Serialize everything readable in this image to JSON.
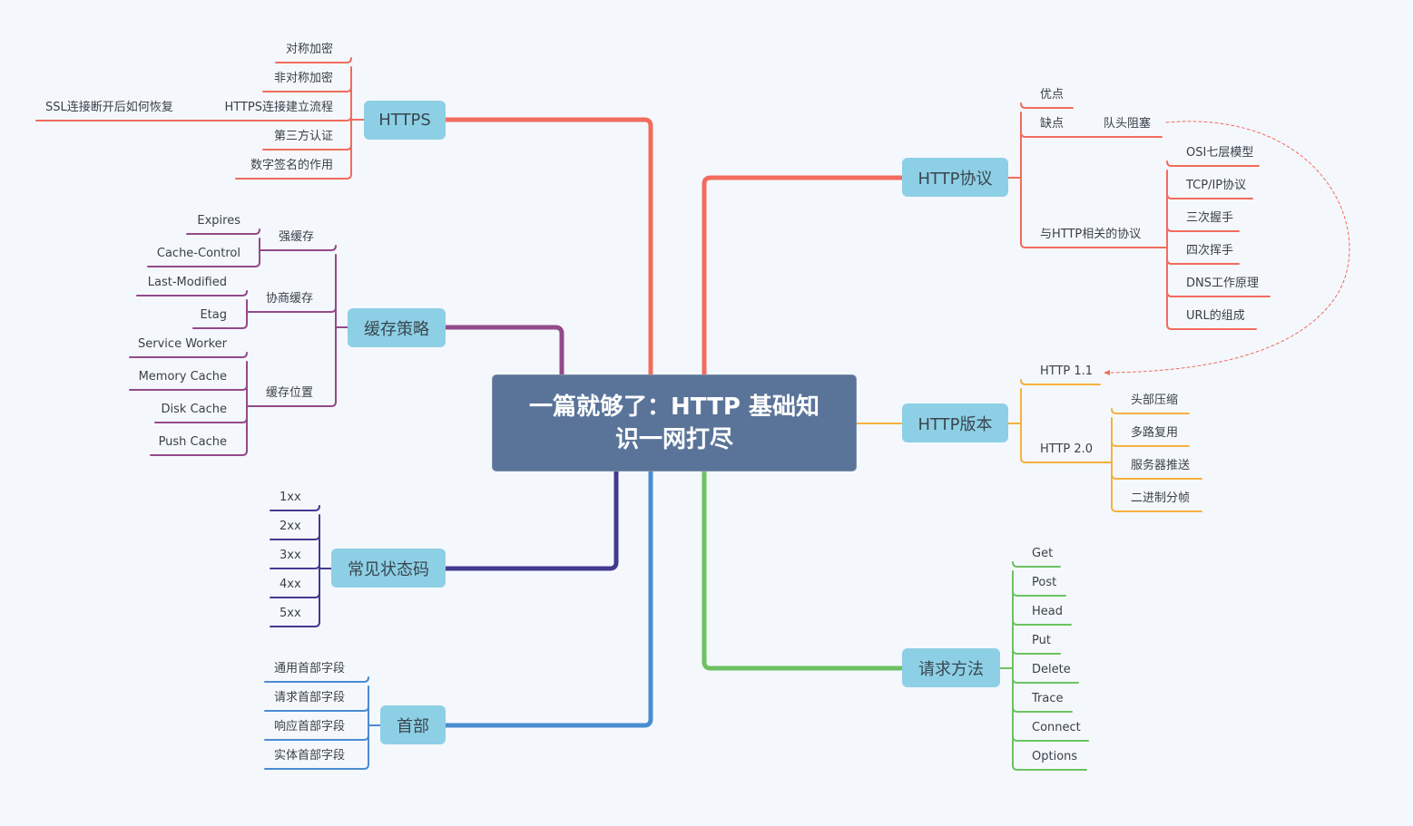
{
  "root": {
    "title": "一篇就够了：HTTP 基础知识一网打尽"
  },
  "colors": {
    "https": "#f26b5c",
    "cache": "#934a8a",
    "status": "#433a91",
    "header": "#4a8cd2",
    "protocol": "#f26b5c",
    "version": "#f5b03e",
    "methods": "#6cc261",
    "topic_fill": "#8dd0e5",
    "root_fill": "#5a7499",
    "background": "#f4f8fd"
  },
  "branches": {
    "https": {
      "label": "HTTPS",
      "children": [
        "对称加密",
        "非对称加密",
        "HTTPS连接建立流程",
        "第三方认证",
        "数字签名的作用"
      ],
      "grandchild": "SSL连接断开后如何恢复"
    },
    "cache": {
      "label": "缓存策略",
      "groups": [
        {
          "label": "强缓存",
          "children": [
            "Expires",
            "Cache-Control"
          ]
        },
        {
          "label": "协商缓存",
          "children": [
            "Last-Modified",
            "Etag"
          ]
        },
        {
          "label": "缓存位置",
          "children": [
            "Service Worker",
            "Memory Cache",
            "Disk Cache",
            "Push Cache"
          ]
        }
      ]
    },
    "status": {
      "label": "常见状态码",
      "children": [
        "1xx",
        "2xx",
        "3xx",
        "4xx",
        "5xx"
      ]
    },
    "header": {
      "label": "首部",
      "children": [
        "通用首部字段",
        "请求首部字段",
        "响应首部字段",
        "实体首部字段"
      ]
    },
    "protocol": {
      "label": "HTTP协议",
      "children": [
        "优点",
        "缺点",
        "与HTTP相关的协议"
      ],
      "drawback_child": "队头阻塞",
      "related": [
        "OSI七层模型",
        "TCP/IP协议",
        "三次握手",
        "四次挥手",
        "DNS工作原理",
        "URL的组成"
      ]
    },
    "version": {
      "label": "HTTP版本",
      "children": [
        "HTTP 1.1",
        "HTTP 2.0"
      ],
      "http2": [
        "头部压缩",
        "多路复用",
        "服务器推送",
        "二进制分帧"
      ]
    },
    "methods": {
      "label": "请求方法",
      "children": [
        "Get",
        "Post",
        "Head",
        "Put",
        "Delete",
        "Trace",
        "Connect",
        "Options"
      ]
    }
  },
  "relationship": {
    "from": "队头阻塞",
    "to": "HTTP 1.1",
    "style": "dashed"
  }
}
